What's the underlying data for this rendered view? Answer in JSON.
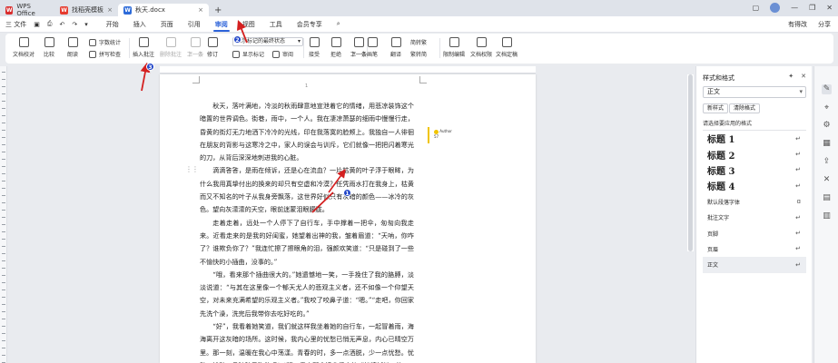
{
  "titlebar": {
    "tabs": [
      {
        "label": "WPS Office",
        "logo": "W"
      },
      {
        "label": "找稻壳模板",
        "logo": "W"
      },
      {
        "label": "秋天.docx",
        "logo": "W"
      }
    ],
    "new_tab": "+",
    "right_label": "",
    "window_controls": [
      "minimize-icon",
      "restore-icon",
      "close-icon"
    ]
  },
  "menubar": {
    "file_label": "三 文件",
    "items": [
      "开始",
      "插入",
      "页面",
      "引用",
      "审阅",
      "视图",
      "工具",
      "会员专享"
    ],
    "active": "审阅",
    "right": [
      "有得改",
      "分享"
    ]
  },
  "ribbon": {
    "doc_proof": "文档校对",
    "compare": "比较",
    "read_aloud": "朗读",
    "word_count": "字数统计",
    "spell_check": "拼写检查",
    "insert_comment": "插入批注",
    "delete_comment": "删除批注",
    "prev": "上一条",
    "next": "下一条",
    "revise": "修订",
    "display_status": "显示标记的最终状态",
    "show_markup": "显示标记",
    "review": "审阅",
    "accept": "接受",
    "reject": "拒绝",
    "prev2": "上一条",
    "next2": "下一条",
    "ink": "画笔",
    "translate": "翻译",
    "simp_trad": "简转繁",
    "trad_simp": "繁转简",
    "restrict_edit": "限制编辑",
    "doc_auth": "文档权限",
    "doc_protect": "文档定稿"
  },
  "document": {
    "page_number": "1",
    "paragraphs": [
      "秋天，落叶满地，冷淡的秋雨肆意地宣泄着它的情绪，用悲凉装饰这个暗置的世界调色。街巷，雨中，一个人。我在凄凉萧瑟的细雨中慢慢行走，昏黄的街灯无力地洒下冷冷的光线，印在我落寞的脸颊上。我独自一人徘徊在朋友的背影与这寒冷之中，家人的误会与训斥，它们就像一把把闪着寒光的刀，从背后深深地刺进我的心脏。",
      "滴滴答答，是雨在倾诉，还是心在流血？一片枯黄的叶子浮于眼眸，为什么我用真挚付出的换来的却只有空虚和冷漠？任凭雨水打在我身上，枯黄而又不知名的叶子从我身旁飘落，这世界好似只有灰暗的颜色——冰冷的灰色。望向灰濛濛的天空，眼前迷蒙泪眼朦胧。",
      "走着走着，远处一个人停下了自行车，手中撑着一把伞，匆匆向我走来。近看走来的是我的好闺蜜，她望着出神的我，皱着眉道：“天呐，你咋了？谁欺负你了？”我连忙擦了擦眼角的泪，强颜欢笑道：“只是碰到了一些不愉快的小插曲，没事的。”",
      "“哦，看来那个插曲很大的。”她遗憾地一笑，一手挽住了我的胳膊，淡淡说道：“与其在这里像一个郁天尤人的悲观主义者，还不如像一个仰望天空，对未来充满希望的乐观主义者。”我咬了咬鼻子道：“嗯。”“走吧，你回家先洗个澡，洗完后我带你去吃好吃的。”",
      "“好”，我看着她笑道，我们就这样我坐着她的自行车，一起冒着雨，海海离开这灰暗的场所。这时候，我内心里的忧愁已悄无声息，内心已晴空万里。那一刻，温暖在我心中荡漾。青春的时，多一点洒脱，少一点忧愁。忧愁，忧愁，且随秋风吹散吧！“哦，看来那个插曲很大的。”她遗憾地一笑，"
    ],
    "comment": {
      "author": "Author",
      "time": "57"
    }
  },
  "panel": {
    "title": "样式和格式",
    "current_style": "正文",
    "new_style": "新样式",
    "clear_format": "清除格式",
    "apply_label": "请选择要应用的格式",
    "styles": [
      {
        "name": "标题 1",
        "heading": true,
        "mark": "↵"
      },
      {
        "name": "标题 2",
        "heading": true,
        "mark": "↵"
      },
      {
        "name": "标题 3",
        "heading": true,
        "mark": "↵"
      },
      {
        "name": "标题 4",
        "heading": true,
        "mark": "↵"
      },
      {
        "name": "默认段落字体",
        "heading": false,
        "mark": "ɑ"
      },
      {
        "name": "批注文字",
        "heading": false,
        "mark": "↵"
      },
      {
        "name": "页脚",
        "heading": false,
        "mark": "↵"
      },
      {
        "name": "页眉",
        "heading": false,
        "mark": "↵"
      },
      {
        "name": "正文",
        "heading": false,
        "mark": "↵",
        "selected": true
      }
    ]
  },
  "annotations": {
    "one": "1",
    "two": "2",
    "three": "3"
  },
  "colors": {
    "accent": "#2c62d9",
    "badge": "#2246c8",
    "arrow": "#d42020",
    "comment": "#f0c400"
  }
}
